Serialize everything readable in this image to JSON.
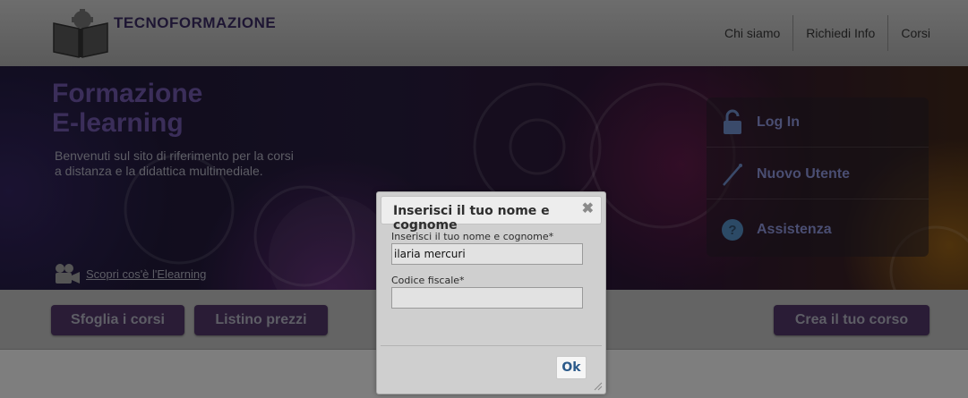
{
  "header": {
    "brand": "TECNOFORMAZIONE",
    "nav": [
      "Chi siamo",
      "Richiedi Info",
      "Corsi"
    ]
  },
  "hero": {
    "title_line1": "Formazione",
    "title_line2": "E-learning",
    "text_line1": "Benvenuti sul sito di riferimento per la corsi",
    "text_line2": "a distanza e la didattica multimediale.",
    "elearning_link": "Scopri cos'è l'Elearning"
  },
  "panel": {
    "items": [
      {
        "label": "Log In",
        "icon": "padlock-icon"
      },
      {
        "label": "Nuovo Utente",
        "icon": "pen-icon"
      },
      {
        "label": "Assistenza",
        "icon": "help-icon"
      }
    ]
  },
  "actions": {
    "browse": "Sfoglia i corsi",
    "prices": "Listino prezzi",
    "create": "Crea il tuo corso"
  },
  "dialog": {
    "title": "Inserisci il tuo nome e cognome",
    "close": "✖",
    "name_label": "Inserisci il tuo nome e cognome*",
    "name_value": "ilaria mercuri",
    "fiscal_label": "Codice fiscale*",
    "fiscal_value": "",
    "ok": "Ok"
  },
  "colors": {
    "accent_button": "#2a1c36",
    "link_blue": "#2b5a8a"
  }
}
